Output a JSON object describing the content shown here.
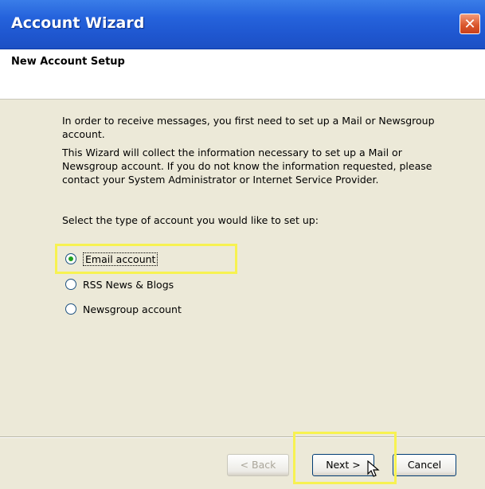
{
  "window": {
    "title": "Account Wizard",
    "close_icon": "close-icon"
  },
  "header": {
    "title": "New Account Setup"
  },
  "content": {
    "paragraph_1": "In order to receive messages, you first need to set up a Mail or Newsgroup account.",
    "paragraph_2": "This Wizard will collect the information necessary to set up a Mail or Newsgroup account. If you do not know the information requested, please contact your System Administrator or Internet Service Provider.",
    "prompt": "Select the type of account you would like to set up:",
    "options": [
      {
        "label": "Email account",
        "selected": true
      },
      {
        "label": "RSS News & Blogs",
        "selected": false
      },
      {
        "label": "Newsgroup account",
        "selected": false
      }
    ]
  },
  "buttons": {
    "back": "< Back",
    "next": "Next >",
    "cancel": "Cancel"
  },
  "colors": {
    "titlebar": "#2563dc",
    "highlight": "#f7f251",
    "radio_selected": "#21a121",
    "window_bg": "#ece9d8"
  }
}
